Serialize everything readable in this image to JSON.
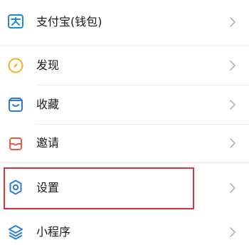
{
  "menu": {
    "items": [
      {
        "label": "支付宝(钱包)",
        "icon": "wallet-icon"
      },
      {
        "label": "发现",
        "icon": "compass-icon"
      },
      {
        "label": "收藏",
        "icon": "favorites-box-icon"
      },
      {
        "label": "邀请",
        "icon": "invite-box-icon"
      },
      {
        "label": "设置",
        "icon": "gear-icon"
      },
      {
        "label": "小程序",
        "icon": "layers-icon"
      }
    ]
  },
  "colors": {
    "wallet": "#1f8ad8",
    "discover": "#f4b020",
    "favorites": "#2a7fd4",
    "invite": "#e95b3b",
    "settings": "#2a7fd4",
    "miniprogram": "#2a7fd4",
    "highlight_box": "#d9343c"
  }
}
